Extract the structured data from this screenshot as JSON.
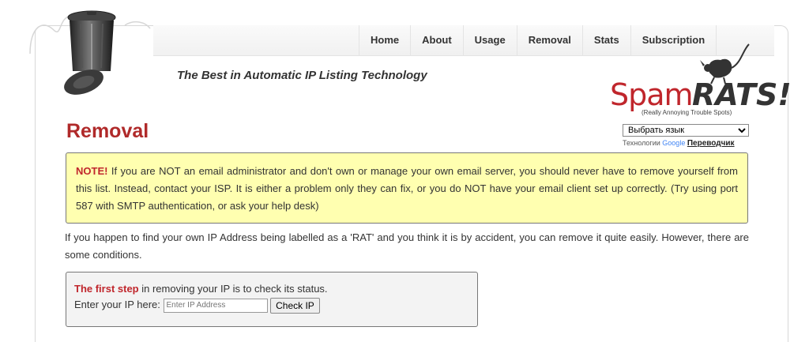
{
  "nav": {
    "items": [
      "Home",
      "About",
      "Usage",
      "Removal",
      "Stats",
      "Subscription"
    ]
  },
  "tagline": "The Best in Automatic IP Listing Technology",
  "logo": {
    "spam": "Spam",
    "rats": "RATS!",
    "sub": "(Really Annoying Trouble Spots)",
    "brand_red": "#c0262c"
  },
  "page_title": "Removal",
  "translate": {
    "select_label": "Выбрать язык",
    "powered_prefix": "Технологии",
    "google": "Google",
    "link": "Переводчик"
  },
  "note": {
    "lead": "NOTE!",
    "text": " If you are NOT an email administrator and don't own or manage your own email server, you should never have to remove yourself from this list. Instead, contact your ISP. It is either a problem only they can fix, or you do NOT have your email client set up correctly. (Try using port 587 with SMTP authentication, or ask your help desk)"
  },
  "intro": "If you happen to find your own IP Address being labelled as a 'RAT' and you think it is by accident, you can remove it quite easily. However, there are some conditions.",
  "check": {
    "lead": "The first step",
    "text": " in removing your IP is to check its status.",
    "label": "Enter your IP here: ",
    "placeholder": "Enter IP Address",
    "button": "Check IP"
  }
}
